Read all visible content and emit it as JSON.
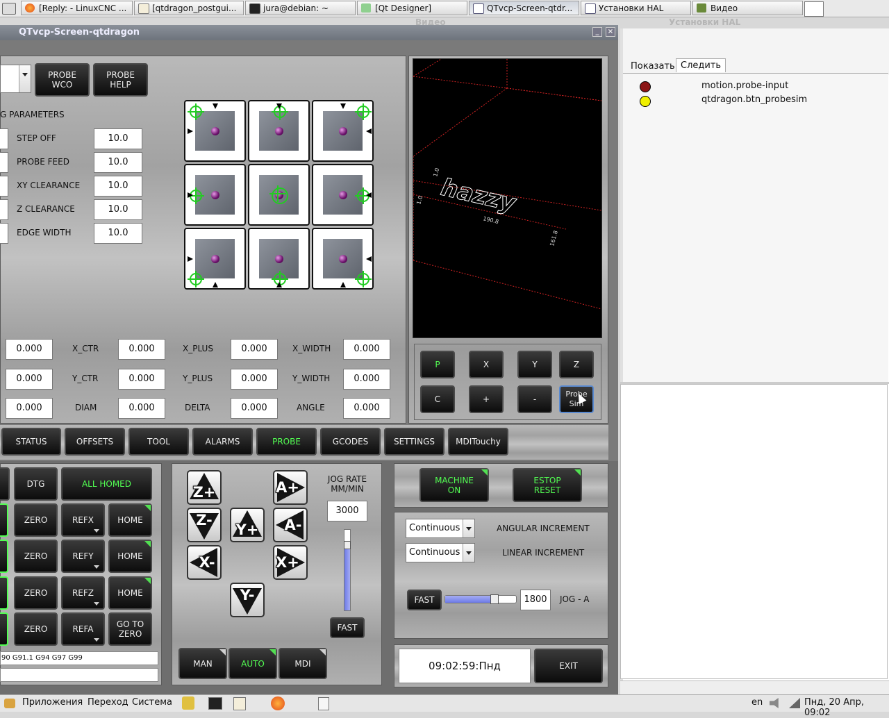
{
  "taskbar": {
    "tasks": [
      {
        "label": "[Reply: - LinuxCNC ...",
        "icon": "firefox-icon"
      },
      {
        "label": "[qtdragon_postgui...",
        "icon": "text-editor-icon"
      },
      {
        "label": "jura@debian: ~",
        "icon": "terminal-icon"
      },
      {
        "label": "[Qt Designer]",
        "icon": "qt-designer-icon"
      },
      {
        "label": "QTvcp-Screen-qtdr...",
        "icon": "window-icon"
      },
      {
        "label": "Установки HAL",
        "icon": "window-icon"
      },
      {
        "label": "Видео",
        "icon": "video-icon"
      }
    ],
    "ghost_titles": [
      "Видео",
      "Установки HAL"
    ]
  },
  "window": {
    "title": "QTvcp-Screen-qtdragon"
  },
  "probe": {
    "buttons": {
      "probe_wco": "PROBE\nWCO",
      "probe_help": "PROBE\nHELP"
    },
    "params_title": "G PARAMETERS",
    "params": [
      {
        "label": "STEP OFF",
        "value": "10.0"
      },
      {
        "label": "PROBE FEED",
        "value": "10.0"
      },
      {
        "label": "XY CLEARANCE",
        "value": "10.0"
      },
      {
        "label": "Z CLEARANCE",
        "value": "10.0"
      },
      {
        "label": "EDGE WIDTH",
        "value": "10.0"
      }
    ],
    "results": [
      [
        {
          "label": "",
          "value": "0.000"
        },
        {
          "label": "X_CTR",
          "value": "0.000"
        },
        {
          "label": "X_PLUS",
          "value": "0.000"
        },
        {
          "label": "X_WIDTH",
          "value": "0.000"
        }
      ],
      [
        {
          "label": "",
          "value": "0.000"
        },
        {
          "label": "Y_CTR",
          "value": "0.000"
        },
        {
          "label": "Y_PLUS",
          "value": "0.000"
        },
        {
          "label": "Y_WIDTH",
          "value": "0.000"
        }
      ],
      [
        {
          "label": "",
          "value": "0.000"
        },
        {
          "label": "DIAM",
          "value": "0.000"
        },
        {
          "label": "DELTA",
          "value": "0.000"
        },
        {
          "label": "ANGLE",
          "value": "0.000"
        }
      ]
    ]
  },
  "preview": {
    "text": "hazzy",
    "dim_labels": [
      "190.8",
      "161.8",
      "1.0",
      "1.0"
    ],
    "view_buttons": [
      "P",
      "X",
      "Y",
      "Z",
      "C",
      "+",
      "-",
      "Probe\nSim"
    ]
  },
  "tabs": [
    "STATUS",
    "OFFSETS",
    "TOOL",
    "ALARMS",
    "PROBE",
    "GCODES",
    "SETTINGS",
    "MDITouchy"
  ],
  "active_tab": "PROBE",
  "dro": {
    "dtg": "DTG",
    "all_homed": "ALL HOMED",
    "rows": [
      {
        "zero": "ZERO",
        "ref": "REFX",
        "home": "HOME"
      },
      {
        "zero": "ZERO",
        "ref": "REFY",
        "home": "HOME"
      },
      {
        "zero": "ZERO",
        "ref": "REFZ",
        "home": "HOME"
      },
      {
        "zero": "ZERO",
        "ref": "REFA",
        "home": "GO TO\nZERO"
      }
    ],
    "gcodes": "90 G91.1 G94 G97 G99"
  },
  "jog": {
    "buttons": [
      "Z+",
      "A+",
      "Z-",
      "Y+",
      "A-",
      "X-",
      "X+",
      "Y-"
    ],
    "rate_label": "JOG RATE\nMM/MIN",
    "rate_value": "3000",
    "rate_slider_fraction": 0.85,
    "fast": "FAST"
  },
  "modes": [
    "MAN",
    "AUTO",
    "MDI"
  ],
  "active_mode": "AUTO",
  "machine": {
    "machine_on": "MACHINE\nON",
    "estop_reset": "ESTOP\nRESET"
  },
  "increments": {
    "angular_value": "Continuous",
    "angular_label": "ANGULAR INCREMENT",
    "linear_value": "Continuous",
    "linear_label": "LINEAR INCREMENT",
    "fast": "FAST",
    "jog_a_value": "1800",
    "jog_a_label": "JOG - A",
    "jog_a_fraction": 0.72
  },
  "clock": {
    "time": "09:02:59:Пнд",
    "exit": "EXIT"
  },
  "hal": {
    "tabs": [
      "Показать",
      "Следить"
    ],
    "active_tab": "Следить",
    "watch": [
      {
        "name": "motion.probe-input",
        "color": "#8b1515"
      },
      {
        "name": "qtdragon.btn_probesim",
        "color": "#f0f000"
      }
    ]
  },
  "bottom": {
    "menus": [
      "Приложения",
      "Переход",
      "Система"
    ],
    "lang": "en",
    "datetime": "Пнд, 20 Апр, 09:02"
  },
  "colors": {
    "accent_green": "#52ff52",
    "corner_green": "#52e052"
  }
}
